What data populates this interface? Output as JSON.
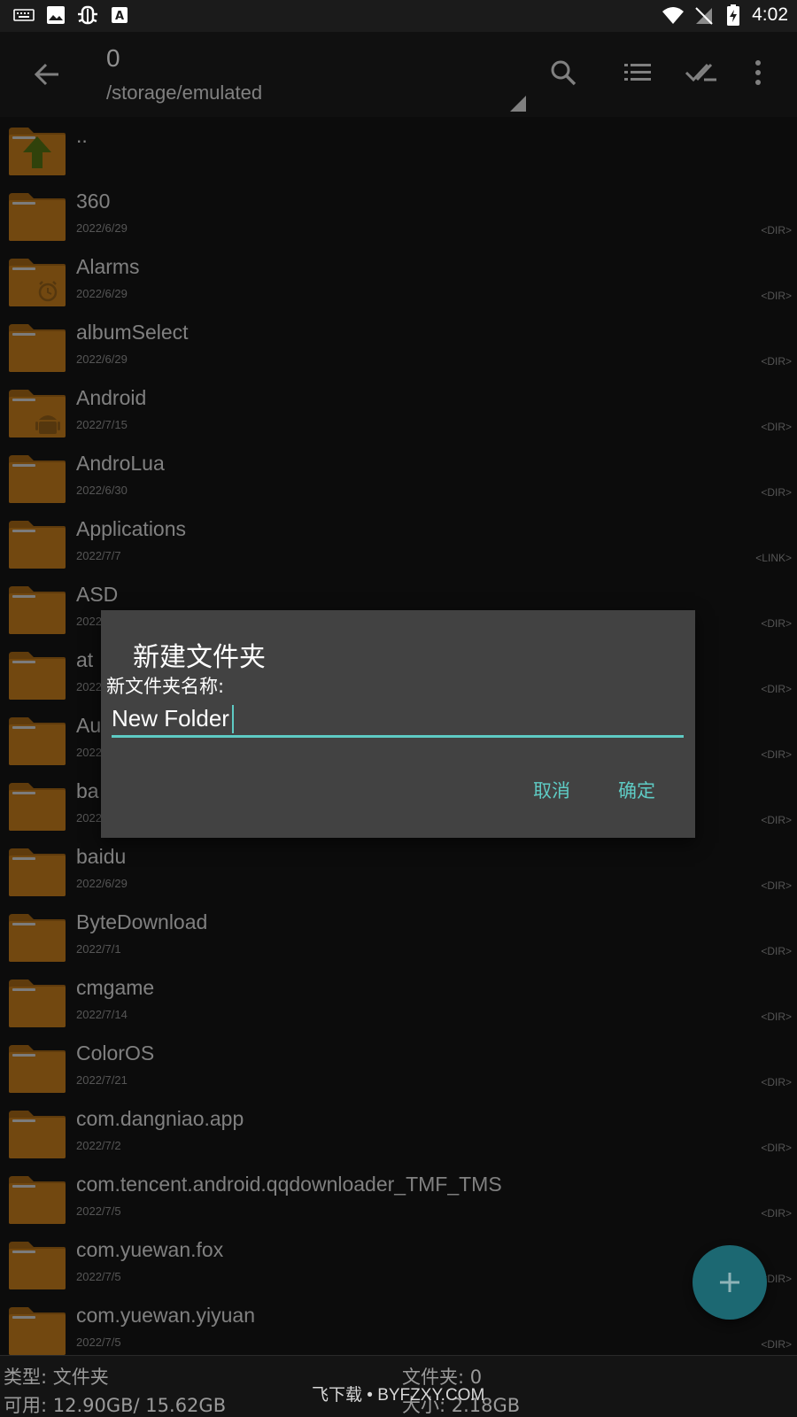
{
  "status_bar": {
    "icons": [
      "keyboard-icon",
      "image-icon",
      "bug-icon",
      "a-box-icon",
      "wifi-icon",
      "no-sim-icon",
      "battery-charging-icon"
    ],
    "time": "4:02"
  },
  "toolbar": {
    "title": "0",
    "path": "/storage/emulated",
    "actions": [
      "search-icon",
      "list-icon",
      "check-all-icon",
      "more-icon"
    ]
  },
  "files": [
    {
      "name": "..",
      "date": "",
      "type": "",
      "icon": "up-arrow"
    },
    {
      "name": "360",
      "date": "2022/6/29",
      "type": "<DIR>",
      "icon": "folder"
    },
    {
      "name": "Alarms",
      "date": "2022/6/29",
      "type": "<DIR>",
      "icon": "alarm"
    },
    {
      "name": "albumSelect",
      "date": "2022/6/29",
      "type": "<DIR>",
      "icon": "folder"
    },
    {
      "name": "Android",
      "date": "2022/7/15",
      "type": "<DIR>",
      "icon": "android"
    },
    {
      "name": "AndroLua",
      "date": "2022/6/30",
      "type": "<DIR>",
      "icon": "folder"
    },
    {
      "name": "Applications",
      "date": "2022/7/7",
      "type": "<LINK>",
      "icon": "folder"
    },
    {
      "name": "ASD",
      "date": "2022",
      "type": "<DIR>",
      "icon": "folder"
    },
    {
      "name": "at",
      "date": "2022",
      "type": "<DIR>",
      "icon": "folder"
    },
    {
      "name": "Au",
      "date": "2022",
      "type": "<DIR>",
      "icon": "folder"
    },
    {
      "name": "ba",
      "date": "2022",
      "type": "<DIR>",
      "icon": "folder"
    },
    {
      "name": "baidu",
      "date": "2022/6/29",
      "type": "<DIR>",
      "icon": "folder"
    },
    {
      "name": "ByteDownload",
      "date": "2022/7/1",
      "type": "<DIR>",
      "icon": "folder"
    },
    {
      "name": "cmgame",
      "date": "2022/7/14",
      "type": "<DIR>",
      "icon": "folder"
    },
    {
      "name": "ColorOS",
      "date": "2022/7/21",
      "type": "<DIR>",
      "icon": "folder"
    },
    {
      "name": "com.dangniao.app",
      "date": "2022/7/2",
      "type": "<DIR>",
      "icon": "folder"
    },
    {
      "name": "com.tencent.android.qqdownloader_TMF_TMS",
      "date": "2022/7/5",
      "type": "<DIR>",
      "icon": "folder"
    },
    {
      "name": "com.yuewan.fox",
      "date": "2022/7/5",
      "type": "<DIR>",
      "icon": "folder"
    },
    {
      "name": "com.yuewan.yiyuan",
      "date": "2022/7/5",
      "type": "<DIR>",
      "icon": "folder"
    }
  ],
  "dialog": {
    "title": "新建文件夹",
    "label": "新文件夹名称:",
    "input_value": "New Folder",
    "cancel": "取消",
    "confirm": "确定"
  },
  "bottom": {
    "type_label": "类型:  文件夹",
    "available_label": "可用:  12.90GB/ 15.62GB",
    "files_count": "文件夹: 0",
    "size": "大小:  2.18GB"
  },
  "watermark": "飞下载 • BYFZXY.COM",
  "colors": {
    "accent": "#5ecbc4",
    "folder": "#b8741a",
    "background": "#141414",
    "dialog": "#424242",
    "fab": "#1c6872"
  }
}
